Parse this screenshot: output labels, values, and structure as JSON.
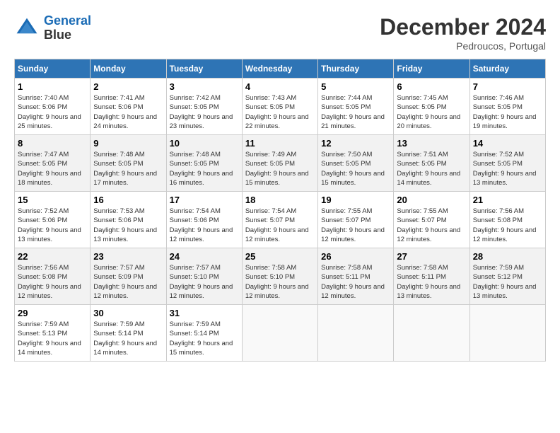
{
  "header": {
    "logo_line1": "General",
    "logo_line2": "Blue",
    "month": "December 2024",
    "location": "Pedroucos, Portugal"
  },
  "weekdays": [
    "Sunday",
    "Monday",
    "Tuesday",
    "Wednesday",
    "Thursday",
    "Friday",
    "Saturday"
  ],
  "days": [
    {
      "num": "1",
      "sunrise": "7:40 AM",
      "sunset": "5:06 PM",
      "daylight": "9 hours and 25 minutes."
    },
    {
      "num": "2",
      "sunrise": "7:41 AM",
      "sunset": "5:06 PM",
      "daylight": "9 hours and 24 minutes."
    },
    {
      "num": "3",
      "sunrise": "7:42 AM",
      "sunset": "5:05 PM",
      "daylight": "9 hours and 23 minutes."
    },
    {
      "num": "4",
      "sunrise": "7:43 AM",
      "sunset": "5:05 PM",
      "daylight": "9 hours and 22 minutes."
    },
    {
      "num": "5",
      "sunrise": "7:44 AM",
      "sunset": "5:05 PM",
      "daylight": "9 hours and 21 minutes."
    },
    {
      "num": "6",
      "sunrise": "7:45 AM",
      "sunset": "5:05 PM",
      "daylight": "9 hours and 20 minutes."
    },
    {
      "num": "7",
      "sunrise": "7:46 AM",
      "sunset": "5:05 PM",
      "daylight": "9 hours and 19 minutes."
    },
    {
      "num": "8",
      "sunrise": "7:47 AM",
      "sunset": "5:05 PM",
      "daylight": "9 hours and 18 minutes."
    },
    {
      "num": "9",
      "sunrise": "7:48 AM",
      "sunset": "5:05 PM",
      "daylight": "9 hours and 17 minutes."
    },
    {
      "num": "10",
      "sunrise": "7:48 AM",
      "sunset": "5:05 PM",
      "daylight": "9 hours and 16 minutes."
    },
    {
      "num": "11",
      "sunrise": "7:49 AM",
      "sunset": "5:05 PM",
      "daylight": "9 hours and 15 minutes."
    },
    {
      "num": "12",
      "sunrise": "7:50 AM",
      "sunset": "5:05 PM",
      "daylight": "9 hours and 15 minutes."
    },
    {
      "num": "13",
      "sunrise": "7:51 AM",
      "sunset": "5:05 PM",
      "daylight": "9 hours and 14 minutes."
    },
    {
      "num": "14",
      "sunrise": "7:52 AM",
      "sunset": "5:05 PM",
      "daylight": "9 hours and 13 minutes."
    },
    {
      "num": "15",
      "sunrise": "7:52 AM",
      "sunset": "5:06 PM",
      "daylight": "9 hours and 13 minutes."
    },
    {
      "num": "16",
      "sunrise": "7:53 AM",
      "sunset": "5:06 PM",
      "daylight": "9 hours and 13 minutes."
    },
    {
      "num": "17",
      "sunrise": "7:54 AM",
      "sunset": "5:06 PM",
      "daylight": "9 hours and 12 minutes."
    },
    {
      "num": "18",
      "sunrise": "7:54 AM",
      "sunset": "5:07 PM",
      "daylight": "9 hours and 12 minutes."
    },
    {
      "num": "19",
      "sunrise": "7:55 AM",
      "sunset": "5:07 PM",
      "daylight": "9 hours and 12 minutes."
    },
    {
      "num": "20",
      "sunrise": "7:55 AM",
      "sunset": "5:07 PM",
      "daylight": "9 hours and 12 minutes."
    },
    {
      "num": "21",
      "sunrise": "7:56 AM",
      "sunset": "5:08 PM",
      "daylight": "9 hours and 12 minutes."
    },
    {
      "num": "22",
      "sunrise": "7:56 AM",
      "sunset": "5:08 PM",
      "daylight": "9 hours and 12 minutes."
    },
    {
      "num": "23",
      "sunrise": "7:57 AM",
      "sunset": "5:09 PM",
      "daylight": "9 hours and 12 minutes."
    },
    {
      "num": "24",
      "sunrise": "7:57 AM",
      "sunset": "5:10 PM",
      "daylight": "9 hours and 12 minutes."
    },
    {
      "num": "25",
      "sunrise": "7:58 AM",
      "sunset": "5:10 PM",
      "daylight": "9 hours and 12 minutes."
    },
    {
      "num": "26",
      "sunrise": "7:58 AM",
      "sunset": "5:11 PM",
      "daylight": "9 hours and 12 minutes."
    },
    {
      "num": "27",
      "sunrise": "7:58 AM",
      "sunset": "5:11 PM",
      "daylight": "9 hours and 13 minutes."
    },
    {
      "num": "28",
      "sunrise": "7:59 AM",
      "sunset": "5:12 PM",
      "daylight": "9 hours and 13 minutes."
    },
    {
      "num": "29",
      "sunrise": "7:59 AM",
      "sunset": "5:13 PM",
      "daylight": "9 hours and 14 minutes."
    },
    {
      "num": "30",
      "sunrise": "7:59 AM",
      "sunset": "5:14 PM",
      "daylight": "9 hours and 14 minutes."
    },
    {
      "num": "31",
      "sunrise": "7:59 AM",
      "sunset": "5:14 PM",
      "daylight": "9 hours and 15 minutes."
    }
  ],
  "labels": {
    "sunrise": "Sunrise:",
    "sunset": "Sunset:",
    "daylight": "Daylight:"
  }
}
